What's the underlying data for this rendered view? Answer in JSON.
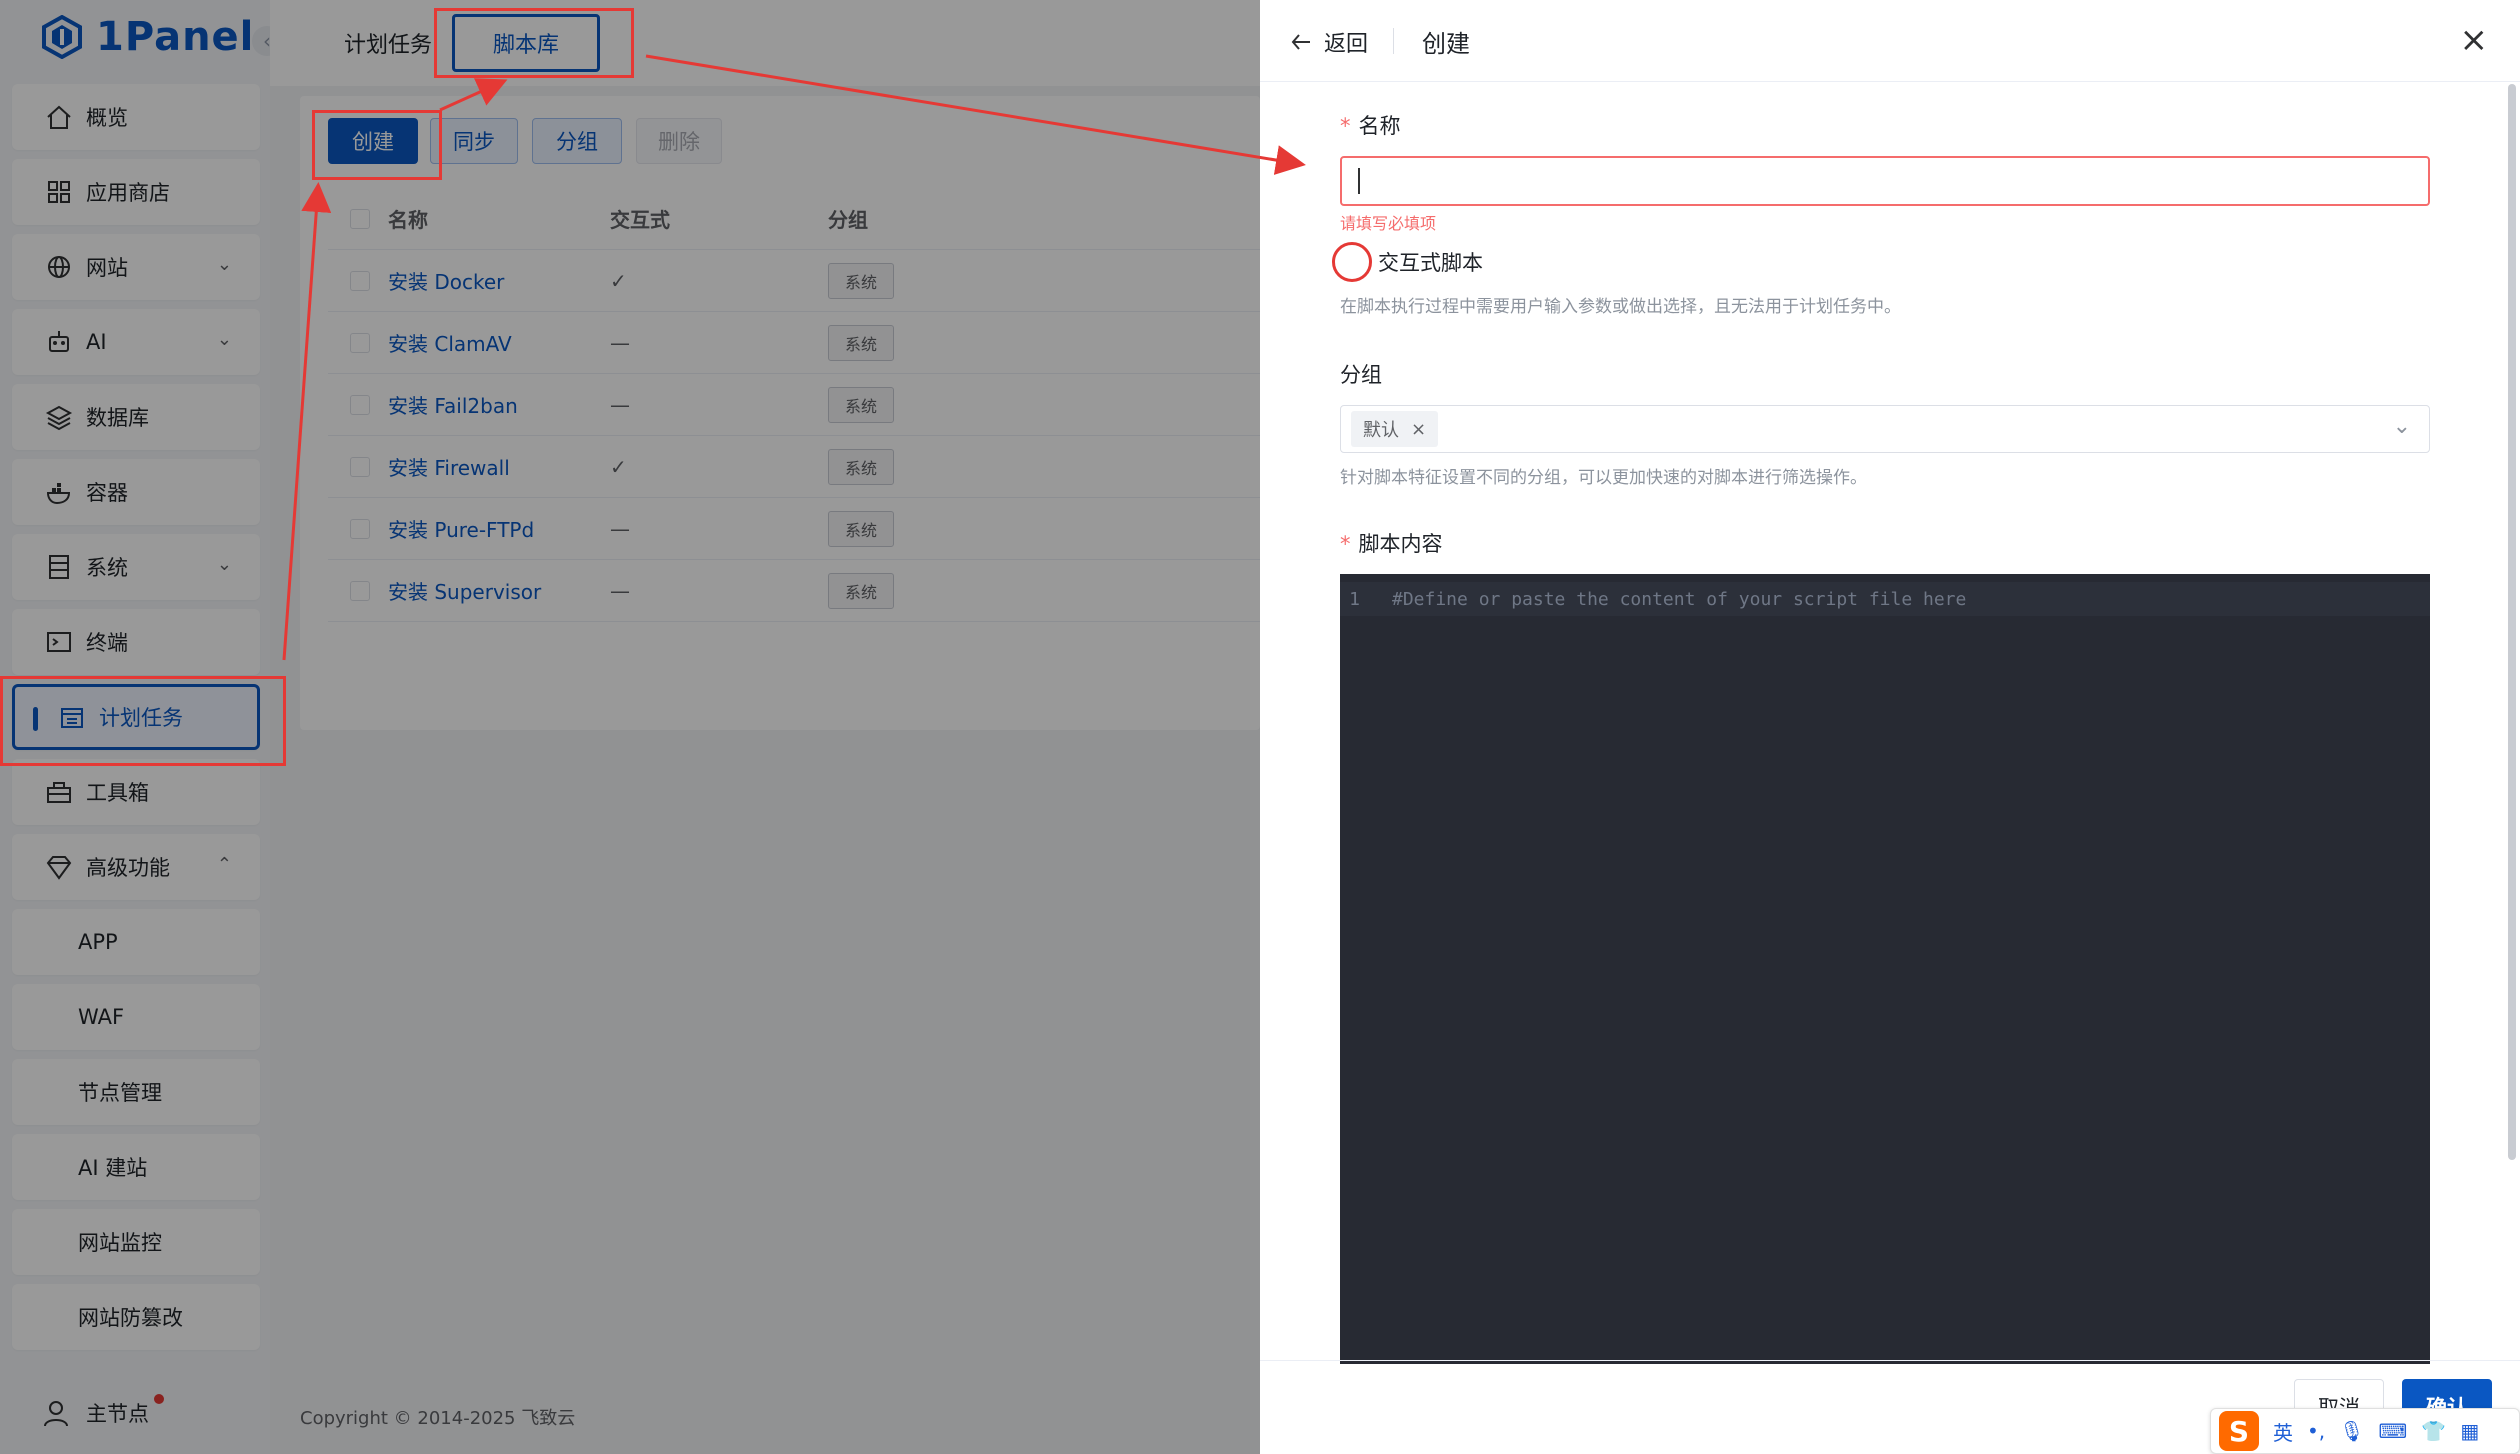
{
  "brand": {
    "name": "1Panel",
    "color": "#0a57c2"
  },
  "sidebar": {
    "items": [
      {
        "label": "概览",
        "icon": "home-icon"
      },
      {
        "label": "应用商店",
        "icon": "grid-icon"
      },
      {
        "label": "网站",
        "icon": "globe-icon"
      },
      {
        "label": "AI",
        "icon": "robot-icon"
      },
      {
        "label": "数据库",
        "icon": "layers-icon"
      },
      {
        "label": "容器",
        "icon": "docker-icon"
      },
      {
        "label": "系统",
        "icon": "server-icon"
      },
      {
        "label": "终端",
        "icon": "terminal-icon"
      },
      {
        "label": "计划任务",
        "icon": "calendar-icon"
      },
      {
        "label": "工具箱",
        "icon": "toolbox-icon"
      },
      {
        "label": "高级功能",
        "icon": "diamond-icon"
      }
    ],
    "sub_items": [
      "APP",
      "WAF",
      "节点管理",
      "AI 建站",
      "网站监控",
      "网站防篡改"
    ],
    "user": "主节点"
  },
  "tabs": [
    "计划任务",
    "脚本库"
  ],
  "toolbar": {
    "create": "创建",
    "sync": "同步",
    "group": "分组",
    "delete": "删除"
  },
  "table": {
    "headers": [
      "名称",
      "交互式",
      "分组"
    ],
    "rows": [
      {
        "name": "安装 Docker",
        "interactive": "✓",
        "group": "系统"
      },
      {
        "name": "安装 ClamAV",
        "interactive": "—",
        "group": "系统"
      },
      {
        "name": "安装 Fail2ban",
        "interactive": "—",
        "group": "系统"
      },
      {
        "name": "安装 Firewall",
        "interactive": "✓",
        "group": "系统"
      },
      {
        "name": "安装 Pure-FTPd",
        "interactive": "—",
        "group": "系统"
      },
      {
        "name": "安装 Supervisor",
        "interactive": "—",
        "group": "系统"
      }
    ]
  },
  "footer": {
    "copyright": "Copyright © 2014-2025 飞致云"
  },
  "drawer": {
    "back": "返回",
    "title": "创建",
    "name_label": "名称",
    "name_error": "请填写必填项",
    "interactive_label": "交互式脚本",
    "interactive_help": "在脚本执行过程中需要用户输入参数或做出选择，且无法用于计划任务中。",
    "group_label": "分组",
    "group_tag": "默认",
    "group_help": "针对脚本特征设置不同的分组，可以更加快速的对脚本进行筛选操作。",
    "content_label": "脚本内容",
    "editor_line_no": "1",
    "editor_placeholder": "#Define or paste the content of your script file here",
    "cancel": "取消",
    "confirm": "确认"
  },
  "ime": {
    "lang": "英"
  }
}
